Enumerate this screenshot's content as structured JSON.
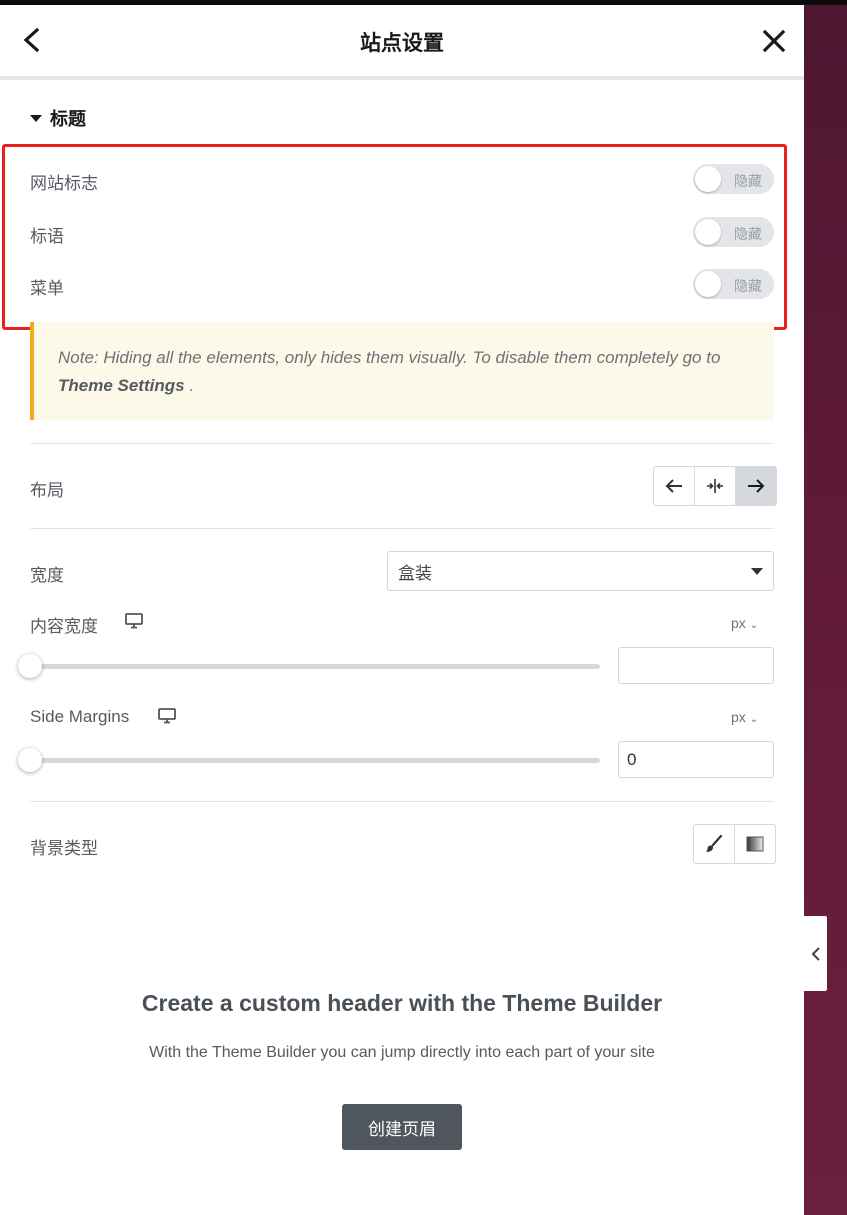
{
  "header": {
    "title": "站点设置"
  },
  "section": {
    "title": "标题"
  },
  "visibility": {
    "items": [
      {
        "label": "网站标志",
        "toggle_text": "隐藏",
        "on": false
      },
      {
        "label": "标语",
        "toggle_text": "隐藏",
        "on": false
      },
      {
        "label": "菜单",
        "toggle_text": "隐藏",
        "on": false
      }
    ]
  },
  "note": {
    "text": "Note: Hiding all the elements, only hides them visually. To disable them completely go to ",
    "link": "Theme Settings",
    "suffix": " ."
  },
  "layout": {
    "label": "布局",
    "options": [
      "left-arrow-icon",
      "center-split-icon",
      "right-arrow-icon"
    ],
    "selected_index": 2
  },
  "width": {
    "label": "宽度",
    "selected": "盒装"
  },
  "content_width": {
    "label": "内容宽度",
    "unit": "px",
    "value": "",
    "slider_fraction": 0
  },
  "side_margins": {
    "label": "Side Margins",
    "unit": "px",
    "value": "0",
    "slider_fraction": 0
  },
  "background": {
    "label": "背景类型",
    "options": [
      "brush-icon",
      "gradient-icon"
    ]
  },
  "promo": {
    "title": "Create a custom header with the Theme Builder",
    "text": "With the Theme Builder you can jump directly into each part of your site",
    "button": "创建页眉"
  },
  "colors": {
    "highlight": "#e8211f",
    "note_border": "#f3a91e",
    "note_bg": "#fdf9e8",
    "canvas_bg": "#5e1a36"
  }
}
